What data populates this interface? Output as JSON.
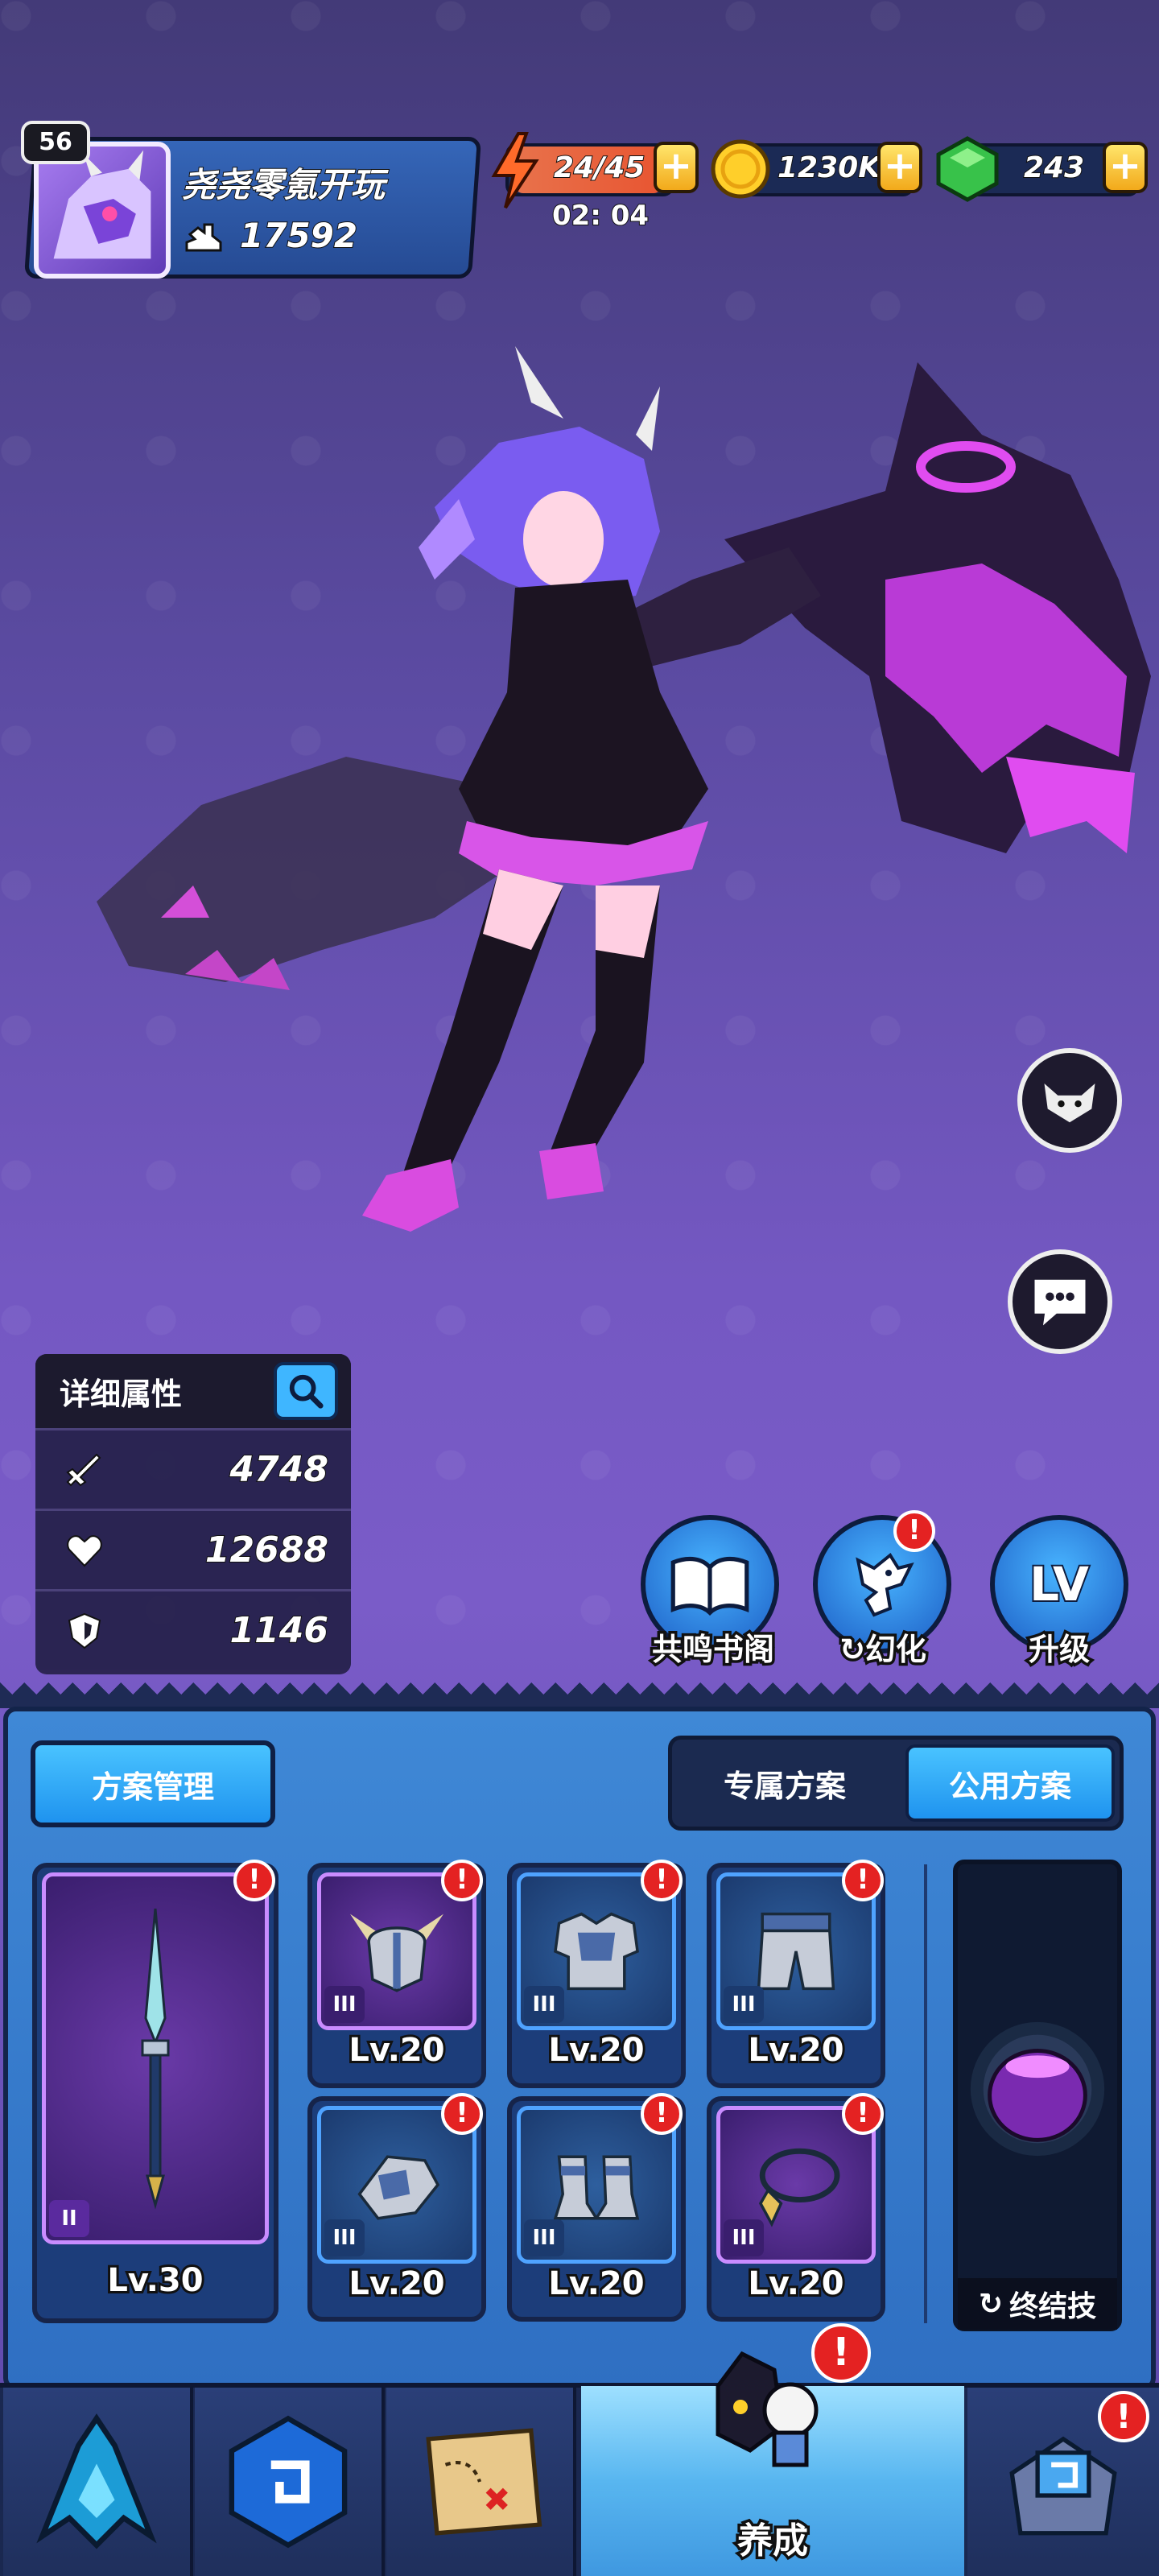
{
  "player": {
    "level": "56",
    "name": "尧尧零氪开玩",
    "power": "17592"
  },
  "resources": {
    "energy": "24/45",
    "energy_timer": "02: 04",
    "gold": "1230K",
    "gems": "243",
    "plus_label": "+"
  },
  "stats": {
    "title": "详细属性",
    "attack": "4748",
    "hp": "12688",
    "defense": "1146"
  },
  "actions": {
    "resonance": "共鸣书阁",
    "illusion": "幻化",
    "upgrade": "升级",
    "upgrade_icon_text": "LV"
  },
  "panel": {
    "plan_manage": "方案管理",
    "tab_exclusive": "专属方案",
    "tab_public": "公用方案",
    "weapon_level": "Lv.30",
    "weapon_tier": "II",
    "gear": [
      {
        "name": "helmet",
        "level": "Lv.20",
        "tier": "III"
      },
      {
        "name": "chest-armor",
        "level": "Lv.20",
        "tier": "III"
      },
      {
        "name": "pants",
        "level": "Lv.20",
        "tier": "III"
      },
      {
        "name": "gauntlet",
        "level": "Lv.20",
        "tier": "III"
      },
      {
        "name": "boots",
        "level": "Lv.20",
        "tier": "III"
      },
      {
        "name": "necklace",
        "level": "Lv.20",
        "tier": "III"
      }
    ],
    "ultimate": "终结技",
    "alert_mark": "!"
  },
  "nav": {
    "active_label": "养成"
  },
  "colors": {
    "accent_blue": "#1f93ef",
    "alert_red": "#e42222",
    "gold": "#f2a91a",
    "gem_green": "#38c24a",
    "purple_rarity": "#c98cff"
  }
}
